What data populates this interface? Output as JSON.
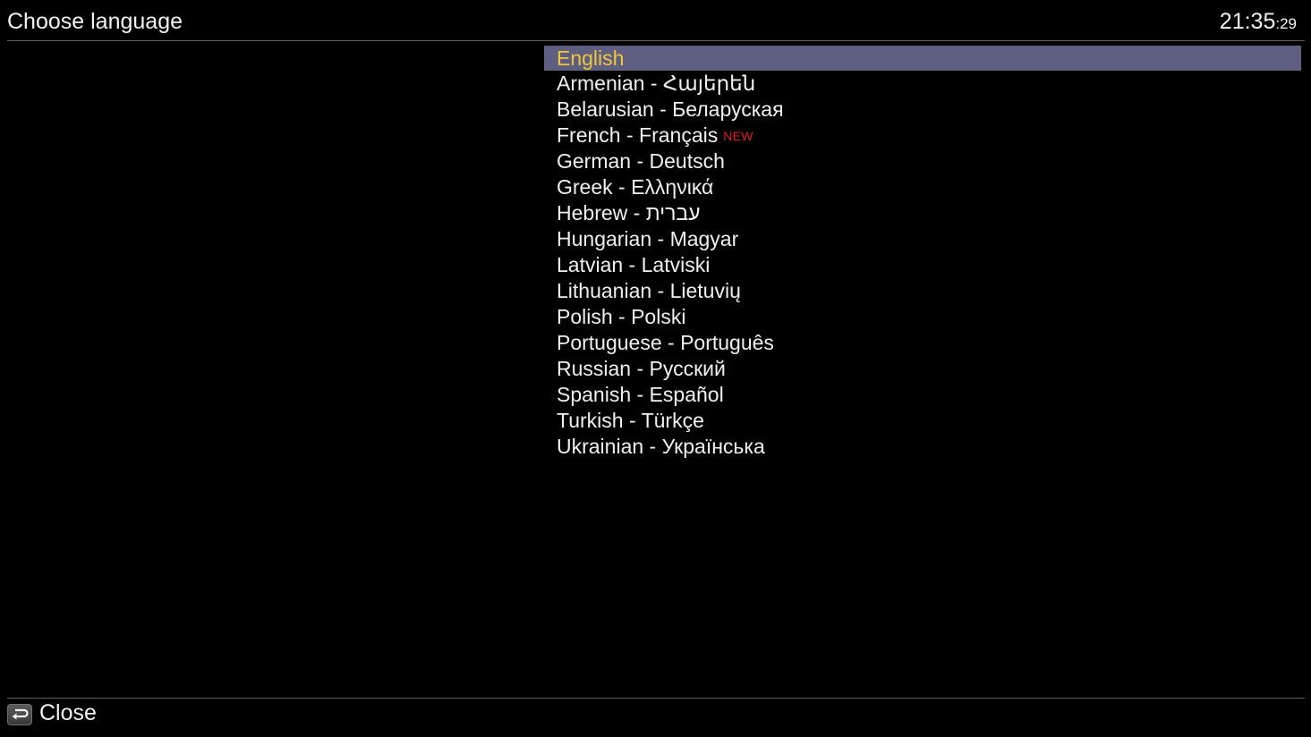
{
  "header": {
    "title": "Choose language",
    "clock": {
      "hm": "21:35",
      "seconds": ":29"
    }
  },
  "languages": [
    {
      "label": "English",
      "selected": true
    },
    {
      "label": "Armenian - Հայերեն"
    },
    {
      "label": "Belarusian - Беларуская"
    },
    {
      "label": "French - Français",
      "badge": "NEW"
    },
    {
      "label": "German - Deutsch"
    },
    {
      "label": "Greek - Ελληνικά"
    },
    {
      "label": "Hebrew - עברית"
    },
    {
      "label": "Hungarian - Magyar"
    },
    {
      "label": "Latvian - Latviski"
    },
    {
      "label": "Lithuanian - Lietuvių"
    },
    {
      "label": "Polish - Polski"
    },
    {
      "label": "Portuguese - Português"
    },
    {
      "label": "Russian - Русский"
    },
    {
      "label": "Spanish - Español"
    },
    {
      "label": "Turkish - Türkçe"
    },
    {
      "label": "Ukrainian - Українська"
    }
  ],
  "footer": {
    "close_label": "Close",
    "close_icon": "back-arrow-icon"
  },
  "colors": {
    "background": "#000000",
    "selection_bg": "#5e5e80",
    "selection_text": "#f0c53a",
    "badge_new": "#e31b1b",
    "divider": "#6b5f4c"
  }
}
